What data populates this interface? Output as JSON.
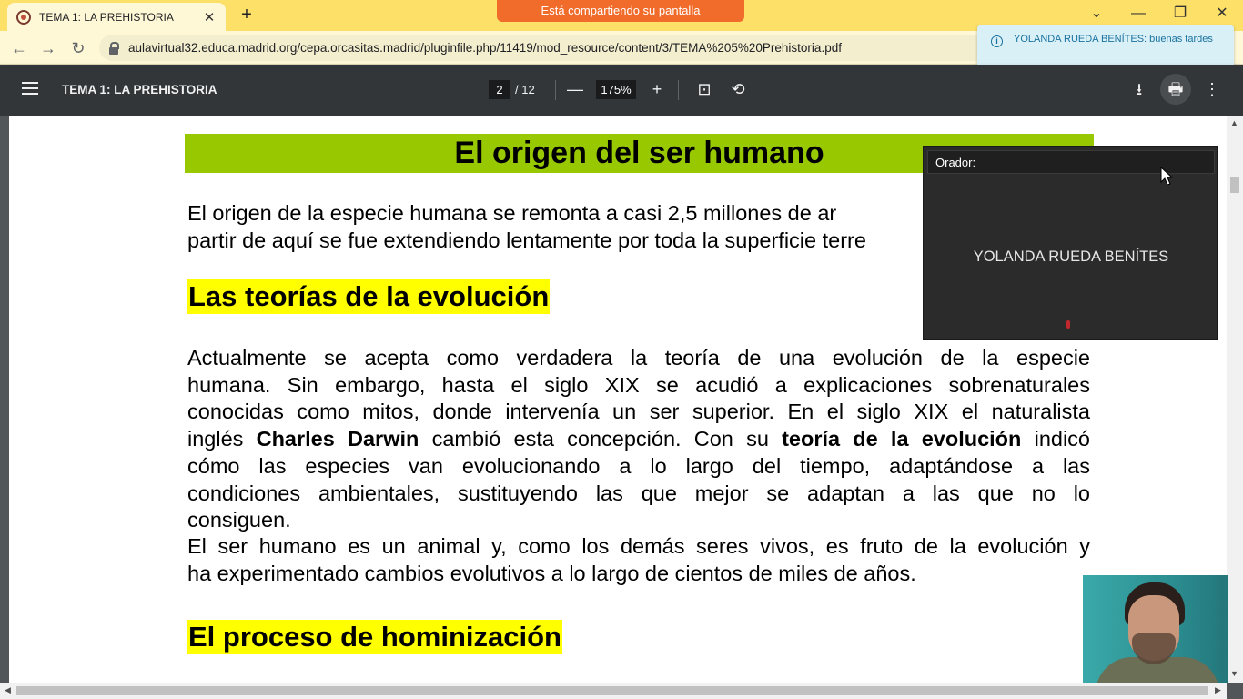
{
  "browser": {
    "tab_title": "TEMA 1: LA PREHISTORIA",
    "tab_close": "✕",
    "new_tab": "+",
    "share_banner": "Está compartiendo su pantalla",
    "url": "aulavirtual32.educa.madrid.org/cepa.orcasitas.madrid/pluginfile.php/11419/mod_resource/content/3/TEMA%205%20Prehistoria.pdf",
    "window_controls": {
      "tab_search": "⌄",
      "minimize": "—",
      "restore": "❐",
      "close": "✕"
    },
    "nav": {
      "back": "←",
      "forward": "→",
      "reload": "↻"
    },
    "accent_color": "#fde068"
  },
  "notification": {
    "text": "YOLANDA RUEDA BENÍTES: buenas tardes",
    "icon": "info-icon"
  },
  "pdf_toolbar": {
    "title": "TEMA 1: LA PREHISTORIA",
    "current_page": "2",
    "total_pages": "/ 12",
    "zoom": "175%",
    "zoom_out": "—",
    "zoom_in": "+",
    "fit_icon": "⊡",
    "rotate_icon": "⟲",
    "download_icon": "⭳",
    "print_icon": "🖶",
    "more_icon": "⋮"
  },
  "document": {
    "heading": "El origen del ser humano",
    "intro_lines": [
      "El origen de la especie humana se remonta a casi 2,5 millones de ar",
      "partir de aquí se fue extendiendo lentamente por toda la superficie terre"
    ],
    "section1_title": "Las teorías de la evolución",
    "section1_lines": [
      "Actualmente se acepta como verdadera la teoría de una evolución de la especie",
      "humana. Sin embargo, hasta el siglo XIX se acudió a explicaciones sobrenaturales",
      "conocidas como mitos, donde intervenía un ser superior. En el siglo XIX el naturalista",
      "cómo las especies van evolucionando a lo largo del tiempo, adaptándose a las",
      "condiciones ambientales, sustituyendo las que mejor se adaptan a las que no lo",
      "consiguen."
    ],
    "darwin_line": {
      "pre": "inglés ",
      "bold1": "Charles Darwin",
      "mid": " cambió esta concepción. Con su ",
      "bold2": "teoría de la evolución",
      "post": " indicó"
    },
    "section1_para2": [
      "El ser humano es un animal y, como los demás seres vivos, es fruto de la evolución y",
      "ha experimentado cambios evolutivos a lo largo de cientos de miles de años."
    ],
    "section2_title": "El proceso de hominización",
    "heading_color": "#97c800",
    "highlight_color": "#ffff00"
  },
  "speaker_panel": {
    "label": "Orador:",
    "speaker_name": "YOLANDA RUEDA BENÍTES"
  }
}
